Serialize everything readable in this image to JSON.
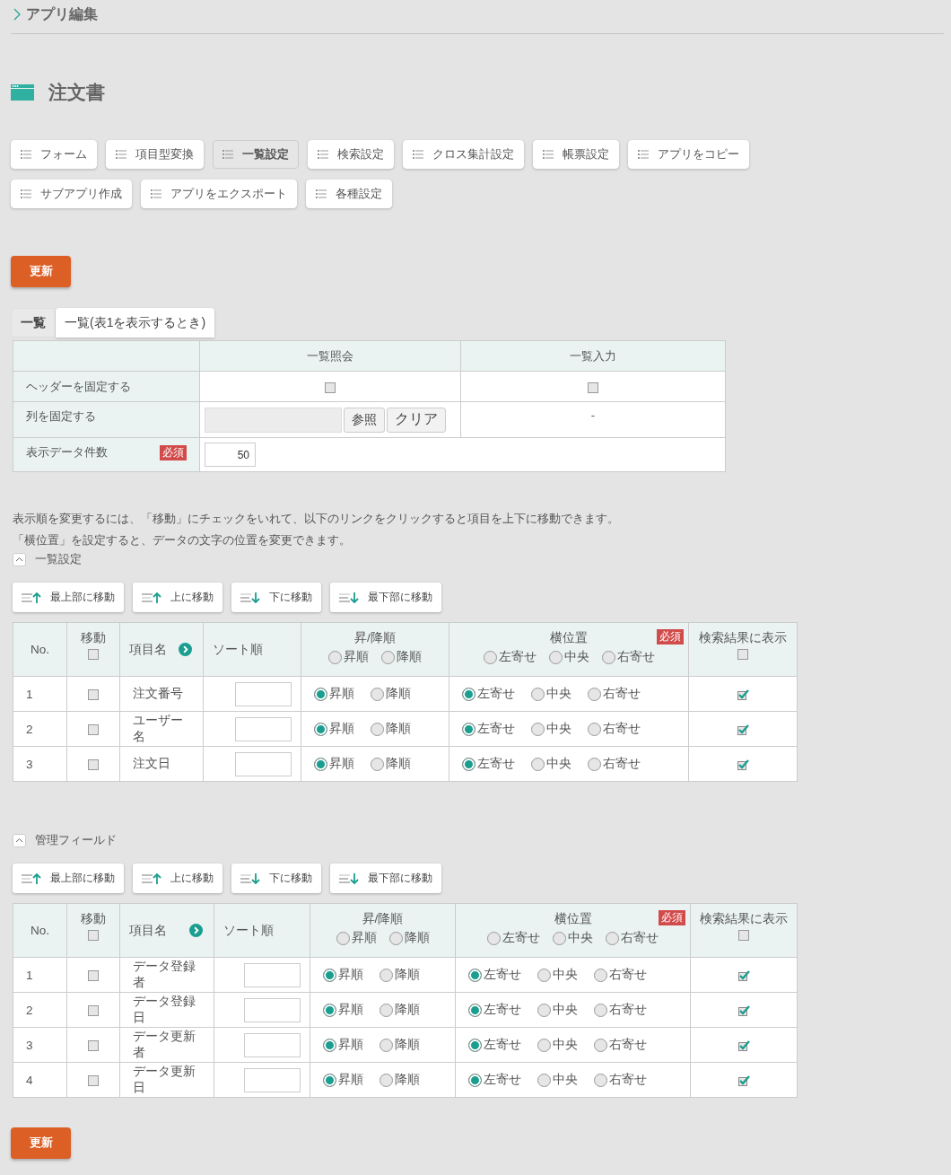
{
  "breadcrumb": "アプリ編集",
  "title": "注文書",
  "menu_buttons": [
    {
      "label": "フォーム",
      "selected": false
    },
    {
      "label": "項目型変換",
      "selected": false
    },
    {
      "label": "一覧設定",
      "selected": true
    },
    {
      "label": "検索設定",
      "selected": false
    },
    {
      "label": "クロス集計設定",
      "selected": false
    },
    {
      "label": "帳票設定",
      "selected": false
    },
    {
      "label": "アプリをコピー",
      "selected": false
    },
    {
      "label": "サブアプリ作成",
      "selected": false
    },
    {
      "label": "アプリをエクスポート",
      "selected": false
    },
    {
      "label": "各種設定",
      "selected": false
    }
  ],
  "update_button": "更新",
  "view_tabs": [
    {
      "label": "一覧",
      "selected": true
    },
    {
      "label": "一覧(表1を表示するとき)",
      "selected": false
    }
  ],
  "settings_table": {
    "columns": [
      "一覧照会",
      "一覧入力"
    ],
    "header_row": {
      "label": "ヘッダーを固定する",
      "checks": [
        false,
        false
      ]
    },
    "column_row": {
      "label": "列を固定する",
      "browse": "参照",
      "clear": "クリア",
      "input_value": "-"
    },
    "count_row": {
      "label": "表示データ件数",
      "badge": "必須",
      "value": "50"
    }
  },
  "instructions": [
    "表示順を変更するには、「移動」にチェックをいれて、以下のリンクをクリックすると項目を上下に移動できます。",
    "「横位置」を設定すると、データの文字の位置を変更できます。"
  ],
  "sections": [
    {
      "title": "一覧設定",
      "expanded": true,
      "move_buttons": [
        {
          "label": "最上部に移動",
          "kind": "up"
        },
        {
          "label": "上に移動",
          "kind": "up"
        },
        {
          "label": "下に移動",
          "kind": "down"
        },
        {
          "label": "最下部に移動",
          "kind": "down"
        }
      ],
      "columns": {
        "no": "No.",
        "move": "移動",
        "move_all": false,
        "name": "項目名",
        "sort": "ソート順",
        "order": "昇/降順",
        "order_options": [
          {
            "label": "昇順",
            "selected": false
          },
          {
            "label": "降順",
            "selected": false
          }
        ],
        "align": "横位置",
        "align_badge": "必須",
        "align_options": [
          {
            "label": "左寄せ",
            "selected": false
          },
          {
            "label": "中央",
            "selected": false
          },
          {
            "label": "右寄せ",
            "selected": false
          }
        ],
        "shown": "検索結果に表示",
        "shown_all": false
      },
      "rows": [
        {
          "no": "1",
          "move": false,
          "name": "注文番号",
          "order": [
            {
              "label": "昇順",
              "selected": true
            },
            {
              "label": "降順",
              "selected": false
            }
          ],
          "align": [
            {
              "label": "左寄せ",
              "selected": true
            },
            {
              "label": "中央",
              "selected": false
            },
            {
              "label": "右寄せ",
              "selected": false
            }
          ],
          "shown": true
        },
        {
          "no": "2",
          "move": false,
          "name": "ユーザー名",
          "order": [
            {
              "label": "昇順",
              "selected": true
            },
            {
              "label": "降順",
              "selected": false
            }
          ],
          "align": [
            {
              "label": "左寄せ",
              "selected": true
            },
            {
              "label": "中央",
              "selected": false
            },
            {
              "label": "右寄せ",
              "selected": false
            }
          ],
          "shown": true
        },
        {
          "no": "3",
          "move": false,
          "name": "注文日",
          "order": [
            {
              "label": "昇順",
              "selected": true
            },
            {
              "label": "降順",
              "selected": false
            }
          ],
          "align": [
            {
              "label": "左寄せ",
              "selected": true
            },
            {
              "label": "中央",
              "selected": false
            },
            {
              "label": "右寄せ",
              "selected": false
            }
          ],
          "shown": true
        }
      ]
    },
    {
      "title": "管理フィールド",
      "expanded": true,
      "move_buttons": [
        {
          "label": "最上部に移動",
          "kind": "up"
        },
        {
          "label": "上に移動",
          "kind": "up"
        },
        {
          "label": "下に移動",
          "kind": "down"
        },
        {
          "label": "最下部に移動",
          "kind": "down"
        }
      ],
      "columns": {
        "no": "No.",
        "move": "移動",
        "move_all": false,
        "name": "項目名",
        "sort": "ソート順",
        "order": "昇/降順",
        "order_options": [
          {
            "label": "昇順",
            "selected": false
          },
          {
            "label": "降順",
            "selected": false
          }
        ],
        "align": "横位置",
        "align_badge": "必須",
        "align_options": [
          {
            "label": "左寄せ",
            "selected": false
          },
          {
            "label": "中央",
            "selected": false
          },
          {
            "label": "右寄せ",
            "selected": false
          }
        ],
        "shown": "検索結果に表示",
        "shown_all": false
      },
      "rows": [
        {
          "no": "1",
          "move": false,
          "name": "データ登録者",
          "order": [
            {
              "label": "昇順",
              "selected": true
            },
            {
              "label": "降順",
              "selected": false
            }
          ],
          "align": [
            {
              "label": "左寄せ",
              "selected": true
            },
            {
              "label": "中央",
              "selected": false
            },
            {
              "label": "右寄せ",
              "selected": false
            }
          ],
          "shown": true
        },
        {
          "no": "2",
          "move": false,
          "name": "データ登録日",
          "order": [
            {
              "label": "昇順",
              "selected": true
            },
            {
              "label": "降順",
              "selected": false
            }
          ],
          "align": [
            {
              "label": "左寄せ",
              "selected": true
            },
            {
              "label": "中央",
              "selected": false
            },
            {
              "label": "右寄せ",
              "selected": false
            }
          ],
          "shown": true
        },
        {
          "no": "3",
          "move": false,
          "name": "データ更新者",
          "order": [
            {
              "label": "昇順",
              "selected": true
            },
            {
              "label": "降順",
              "selected": false
            }
          ],
          "align": [
            {
              "label": "左寄せ",
              "selected": true
            },
            {
              "label": "中央",
              "selected": false
            },
            {
              "label": "右寄せ",
              "selected": false
            }
          ],
          "shown": true
        },
        {
          "no": "4",
          "move": false,
          "name": "データ更新日",
          "order": [
            {
              "label": "昇順",
              "selected": true
            },
            {
              "label": "降順",
              "selected": false
            }
          ],
          "align": [
            {
              "label": "左寄せ",
              "selected": true
            },
            {
              "label": "中央",
              "selected": false
            },
            {
              "label": "右寄せ",
              "selected": false
            }
          ],
          "shown": true
        }
      ]
    }
  ],
  "bottom_update_button": "更新"
}
